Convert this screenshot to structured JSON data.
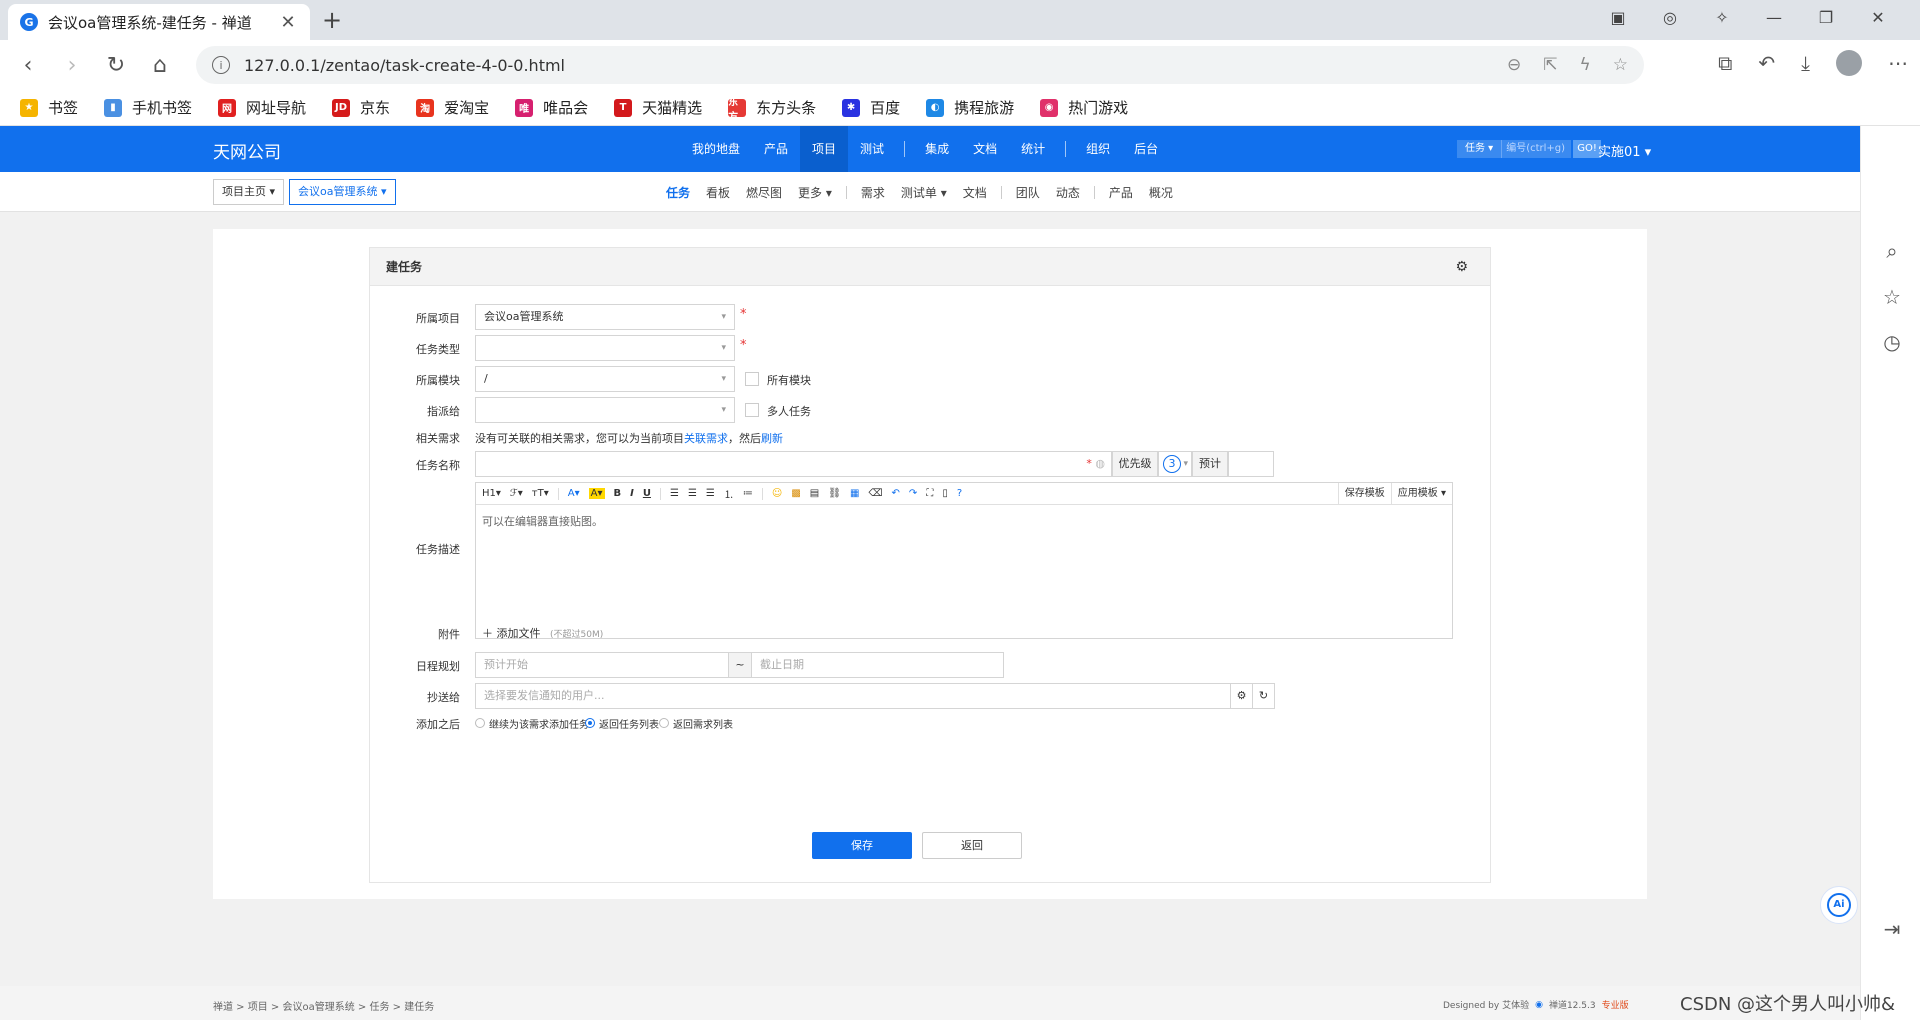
{
  "browser": {
    "tab_title": "会议oa管理系统-建任务 - 禅道",
    "tab_favicon": "G",
    "url": "127.0.0.1/zentao/task-create-4-0-0.html",
    "bookmarks": [
      {
        "label": "书签",
        "color": "#f5b400",
        "glyph": "★"
      },
      {
        "label": "手机书签",
        "color": "#4a90e2",
        "glyph": "▮"
      },
      {
        "label": "网址导航",
        "color": "#e02020",
        "glyph": "网"
      },
      {
        "label": "京东",
        "color": "#d51b1b",
        "glyph": "JD"
      },
      {
        "label": "爱淘宝",
        "color": "#e8341e",
        "glyph": "淘"
      },
      {
        "label": "唯品会",
        "color": "#d6206f",
        "glyph": "唯"
      },
      {
        "label": "天猫精选",
        "color": "#d3191c",
        "glyph": "T"
      },
      {
        "label": "东方头条",
        "color": "#e53935",
        "glyph": "东方"
      },
      {
        "label": "百度",
        "color": "#2932e1",
        "glyph": "✱"
      },
      {
        "label": "携程旅游",
        "color": "#1e88e5",
        "glyph": "◐"
      },
      {
        "label": "热门游戏",
        "color": "#e0306a",
        "glyph": "◉"
      }
    ]
  },
  "app": {
    "company": "天网公司",
    "main_nav": [
      {
        "label": "我的地盘",
        "active": false
      },
      {
        "label": "产品",
        "active": false
      },
      {
        "label": "项目",
        "active": true
      },
      {
        "label": "测试",
        "active": false
      },
      {
        "label": "集成",
        "active": false
      },
      {
        "label": "文档",
        "active": false
      },
      {
        "label": "统计",
        "active": false
      },
      {
        "label": "组织",
        "active": false
      },
      {
        "label": "后台",
        "active": false
      }
    ],
    "search": {
      "type": "任务",
      "placeholder": "编号(ctrl+g)",
      "go": "GO!"
    },
    "user": "实施01",
    "breadcrumb": {
      "home": "项目主页",
      "project": "会议oa管理系统"
    },
    "sub_nav": [
      "任务",
      "看板",
      "燃尽图",
      "更多",
      "需求",
      "测试单",
      "文档",
      "团队",
      "动态",
      "产品",
      "概况"
    ]
  },
  "form": {
    "title": "建任务",
    "project_label": "所属项目",
    "project_value": "会议oa管理系统",
    "type_label": "任务类型",
    "type_value": "",
    "module_label": "所属模块",
    "module_value": "/",
    "all_modules": "所有模块",
    "assign_label": "指派给",
    "assign_value": "",
    "multi_task": "多人任务",
    "story_label": "相关需求",
    "story_text": "没有可关联的相关需求，您可以为当前项目",
    "story_link": "关联需求",
    "story_text2": "，然后",
    "story_refresh": "刷新",
    "name_label": "任务名称",
    "priority_label": "优先级",
    "priority_value": "3",
    "estimate_label": "预计",
    "desc_label": "任务描述",
    "editor_toolbar": [
      "H1",
      "ℱ",
      "тT",
      "A",
      "A",
      "B",
      "I",
      "U"
    ],
    "save_template": "保存模板",
    "apply_template": "应用模板",
    "desc_placeholder": "可以在编辑器直接贴图。",
    "attach_label": "附件",
    "add_file": "添加文件",
    "file_limit": "(不超过50M)",
    "schedule_label": "日程规划",
    "start_placeholder": "预计开始",
    "tilde": "~",
    "deadline_placeholder": "截止日期",
    "cc_label": "抄送给",
    "cc_placeholder": "选择要发信通知的用户...",
    "after_label": "添加之后",
    "after_options": [
      {
        "label": "继续为该需求添加任务",
        "checked": false
      },
      {
        "label": "返回任务列表",
        "checked": true
      },
      {
        "label": "返回需求列表",
        "checked": false
      }
    ],
    "save": "保存",
    "back": "返回"
  },
  "footer": {
    "crumbs": "禅道 > 项目 > 会议oa管理系统 > 任务 > 建任务",
    "designed_by": "Designed by 艾体验",
    "version": "禅道12.5.3",
    "edition": "专业版",
    "watermark": "CSDN @这个男人叫小帅&"
  }
}
